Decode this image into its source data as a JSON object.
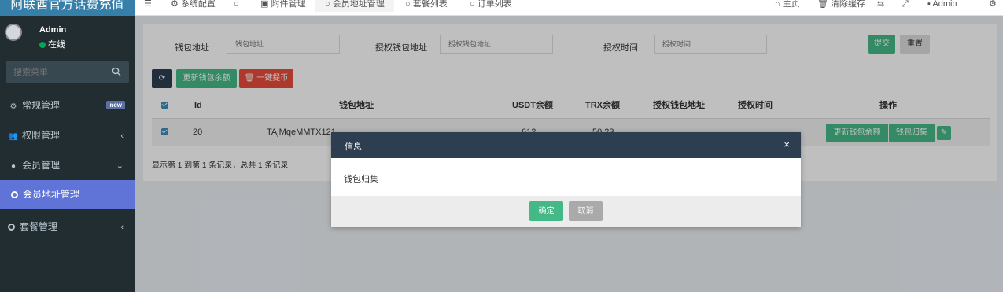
{
  "brand": {
    "title": "阿联酋官方话费充值"
  },
  "user": {
    "name": "Admin",
    "status": "在线"
  },
  "sidebar": {
    "search_placeholder": "搜索菜单",
    "items": [
      {
        "label": "常规管理",
        "badge": "new",
        "icon": "cogs-icon"
      },
      {
        "label": "权限管理",
        "icon": "users-icon"
      },
      {
        "label": "会员管理",
        "icon": "user-circle-icon"
      },
      {
        "label": "会员地址管理",
        "icon": "circle-icon"
      },
      {
        "label": "套餐管理",
        "icon": "circle-icon"
      }
    ]
  },
  "topbar": {
    "tabs": [
      {
        "label": "系统配置"
      },
      {
        "label": ""
      },
      {
        "label": "附件管理"
      },
      {
        "label": "会员地址管理"
      },
      {
        "label": "套餐列表"
      },
      {
        "label": "订单列表"
      }
    ],
    "home": "主页",
    "clear_cache": "清除缓存",
    "admin": "Admin"
  },
  "search_form": {
    "wallet_label": "钱包地址",
    "wallet_placeholder": "钱包地址",
    "auth_wallet_label": "授权钱包地址",
    "auth_wallet_placeholder": "授权钱包地址",
    "auth_time_label": "授权时间",
    "auth_time_placeholder": "授权时间",
    "submit": "提交",
    "reset": "重置"
  },
  "toolbar": {
    "update_balance": "更新钱包余额",
    "one_click": "一键提币"
  },
  "table": {
    "headers": {
      "id": "Id",
      "wallet": "钱包地址",
      "usdt": "USDT余额",
      "trx": "TRX余额",
      "auth_wallet": "授权钱包地址",
      "auth_time": "授权时间",
      "ops": "操作"
    },
    "rows": [
      {
        "id": "20",
        "wallet": "TAjMqeMMTX121",
        "usdt": "612",
        "trx": "50.23",
        "update_btn": "更新钱包余额",
        "collect_btn": "钱包归集"
      }
    ],
    "summary": "显示第 1 到第 1 条记录，总共 1 条记录"
  },
  "modal": {
    "title": "信息",
    "message": "钱包归集",
    "ok": "确定",
    "cancel": "取消"
  },
  "colors": {
    "sidebar_bg": "#222d32",
    "active_item": "#5f74d6",
    "green": "#44b887",
    "red": "#e74c3c",
    "dark_header": "#2c3e50"
  }
}
